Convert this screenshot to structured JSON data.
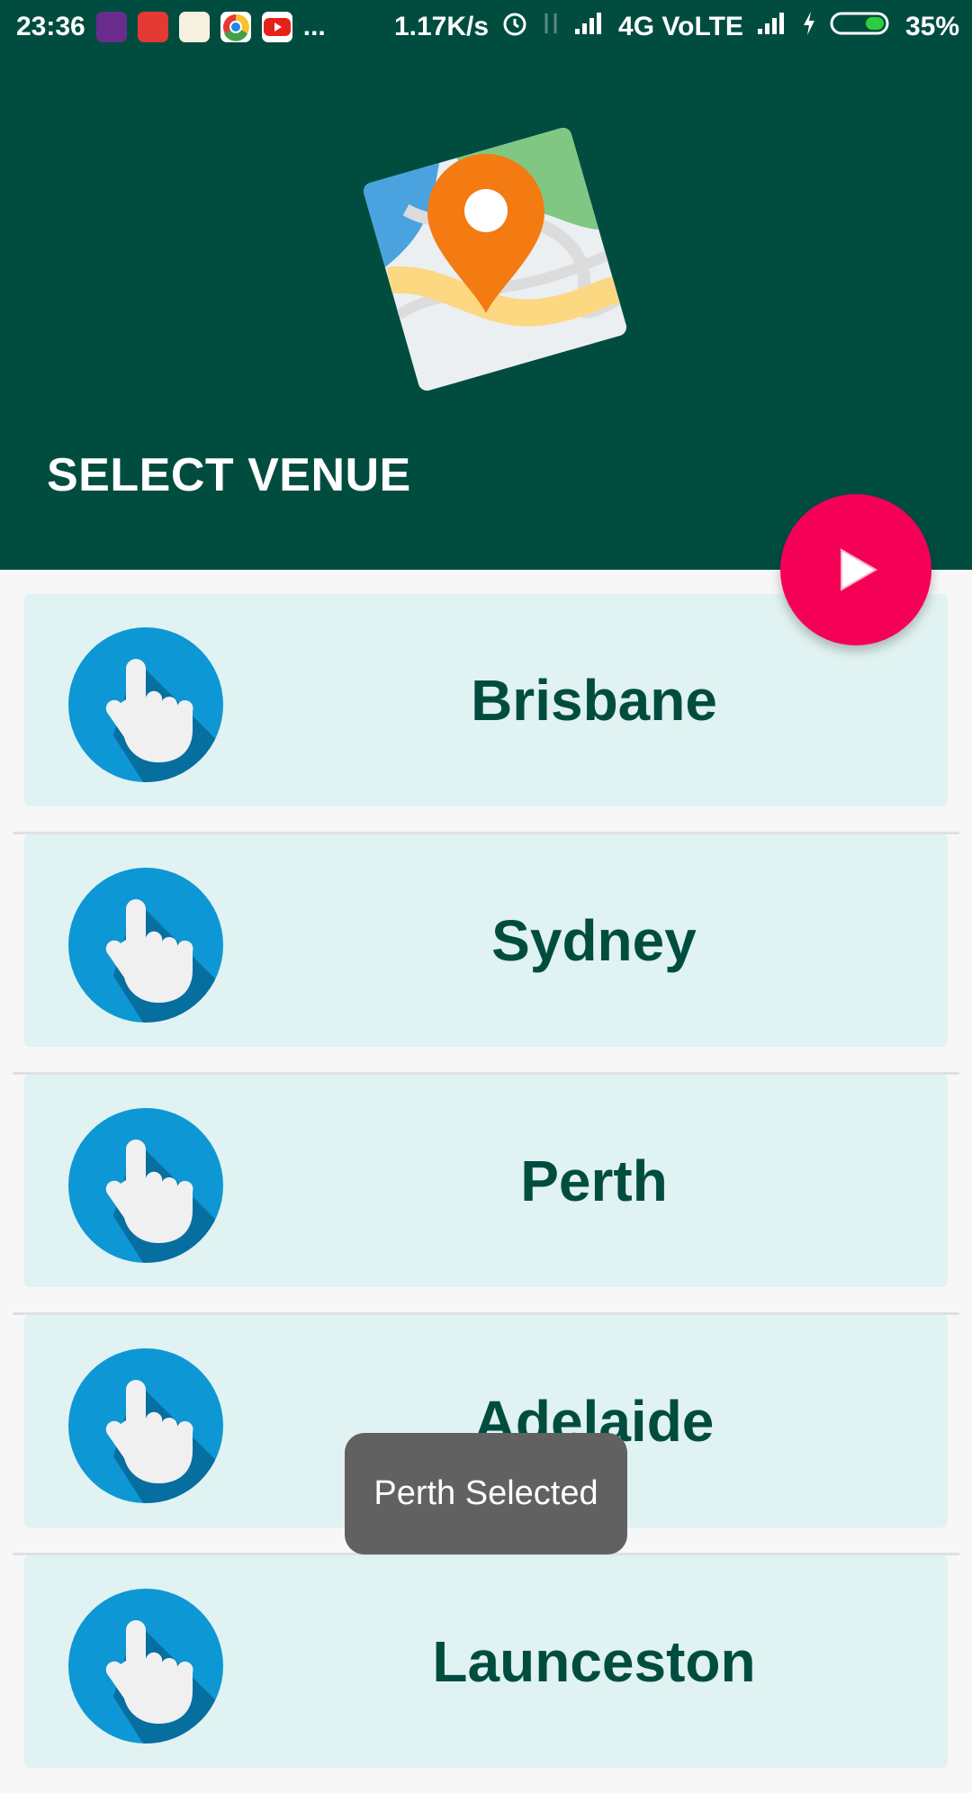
{
  "status_bar": {
    "time": "23:36",
    "dots": "...",
    "net_speed": "1.17K/s",
    "network": "4G VoLTE",
    "battery": "35%"
  },
  "header": {
    "title": "SELECT VENUE"
  },
  "fab": {
    "icon": "play-icon",
    "color": "#f50057"
  },
  "venues": [
    {
      "name": "Brisbane"
    },
    {
      "name": "Sydney"
    },
    {
      "name": "Perth"
    },
    {
      "name": "Adelaide"
    },
    {
      "name": "Launceston"
    }
  ],
  "toast": {
    "message": "Perth Selected"
  },
  "colors": {
    "primary": "#004d40",
    "accent": "#f50057",
    "card": "#e0f2f1",
    "icon_circle": "#0d97d5"
  }
}
